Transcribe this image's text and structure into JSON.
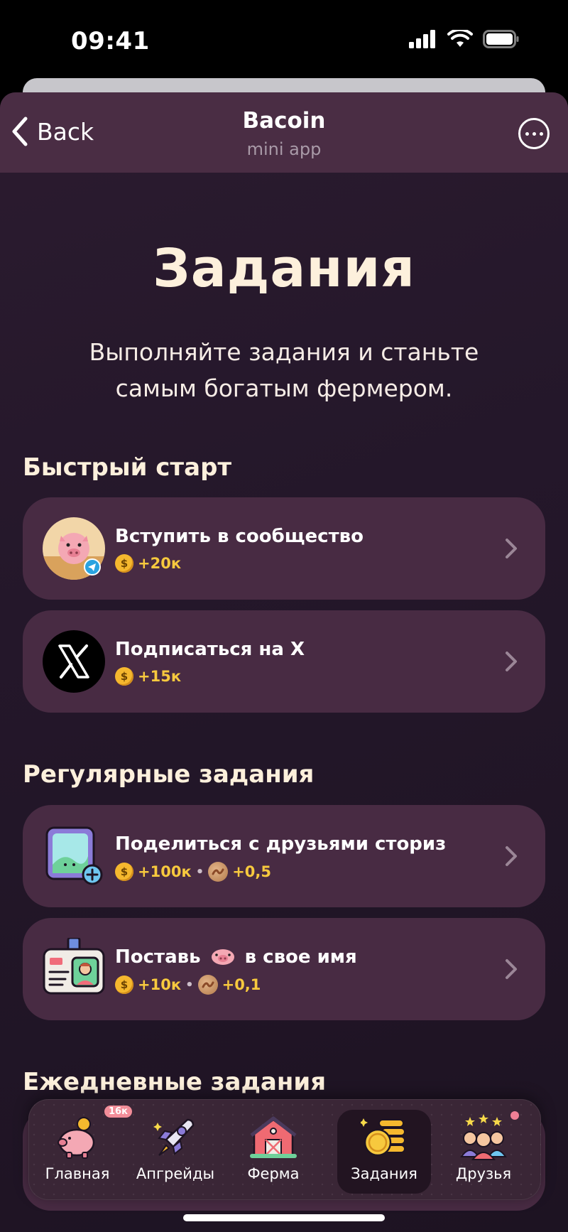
{
  "status_bar": {
    "time": "09:41"
  },
  "nav": {
    "back_label": "Back",
    "title": "Bacoin",
    "subtitle": "mini app"
  },
  "page": {
    "title": "Задания",
    "subtitle": "Выполняйте задания и станьте самым богатым фермером."
  },
  "sections": [
    {
      "title": "Быстрый старт"
    },
    {
      "title": "Регулярные задания"
    },
    {
      "title": "Ежедневные задания"
    }
  ],
  "tasks": [
    {
      "name": "Вступить в сообщество",
      "coins": "+20к",
      "icon": "pig-telegram-icon"
    },
    {
      "name": "Подписаться на X",
      "coins": "+15к",
      "icon": "x-logo-icon"
    },
    {
      "name": "Поделиться с друзьями сториз",
      "coins": "+100к",
      "bacon": "+0,5",
      "icon": "story-share-icon"
    },
    {
      "name_before": "Поставь",
      "name_after": "в свое имя",
      "coins": "+10к",
      "bacon": "+0,1",
      "icon": "id-badge-icon"
    }
  ],
  "tabs": [
    {
      "label": "Главная",
      "badge": "16к",
      "icon": "piggy-bank-icon"
    },
    {
      "label": "Апгрейды",
      "icon": "rocket-icon"
    },
    {
      "label": "Ферма",
      "icon": "barn-icon"
    },
    {
      "label": "Задания",
      "icon": "coins-stack-icon",
      "active": true
    },
    {
      "label": "Друзья",
      "icon": "friends-icon",
      "has_dot": true
    }
  ],
  "colors": {
    "accent_gold": "#f7c93e",
    "card_bg": "#482b43",
    "nav_bg": "#4a2d44",
    "title_cream": "#fdf0dc"
  }
}
